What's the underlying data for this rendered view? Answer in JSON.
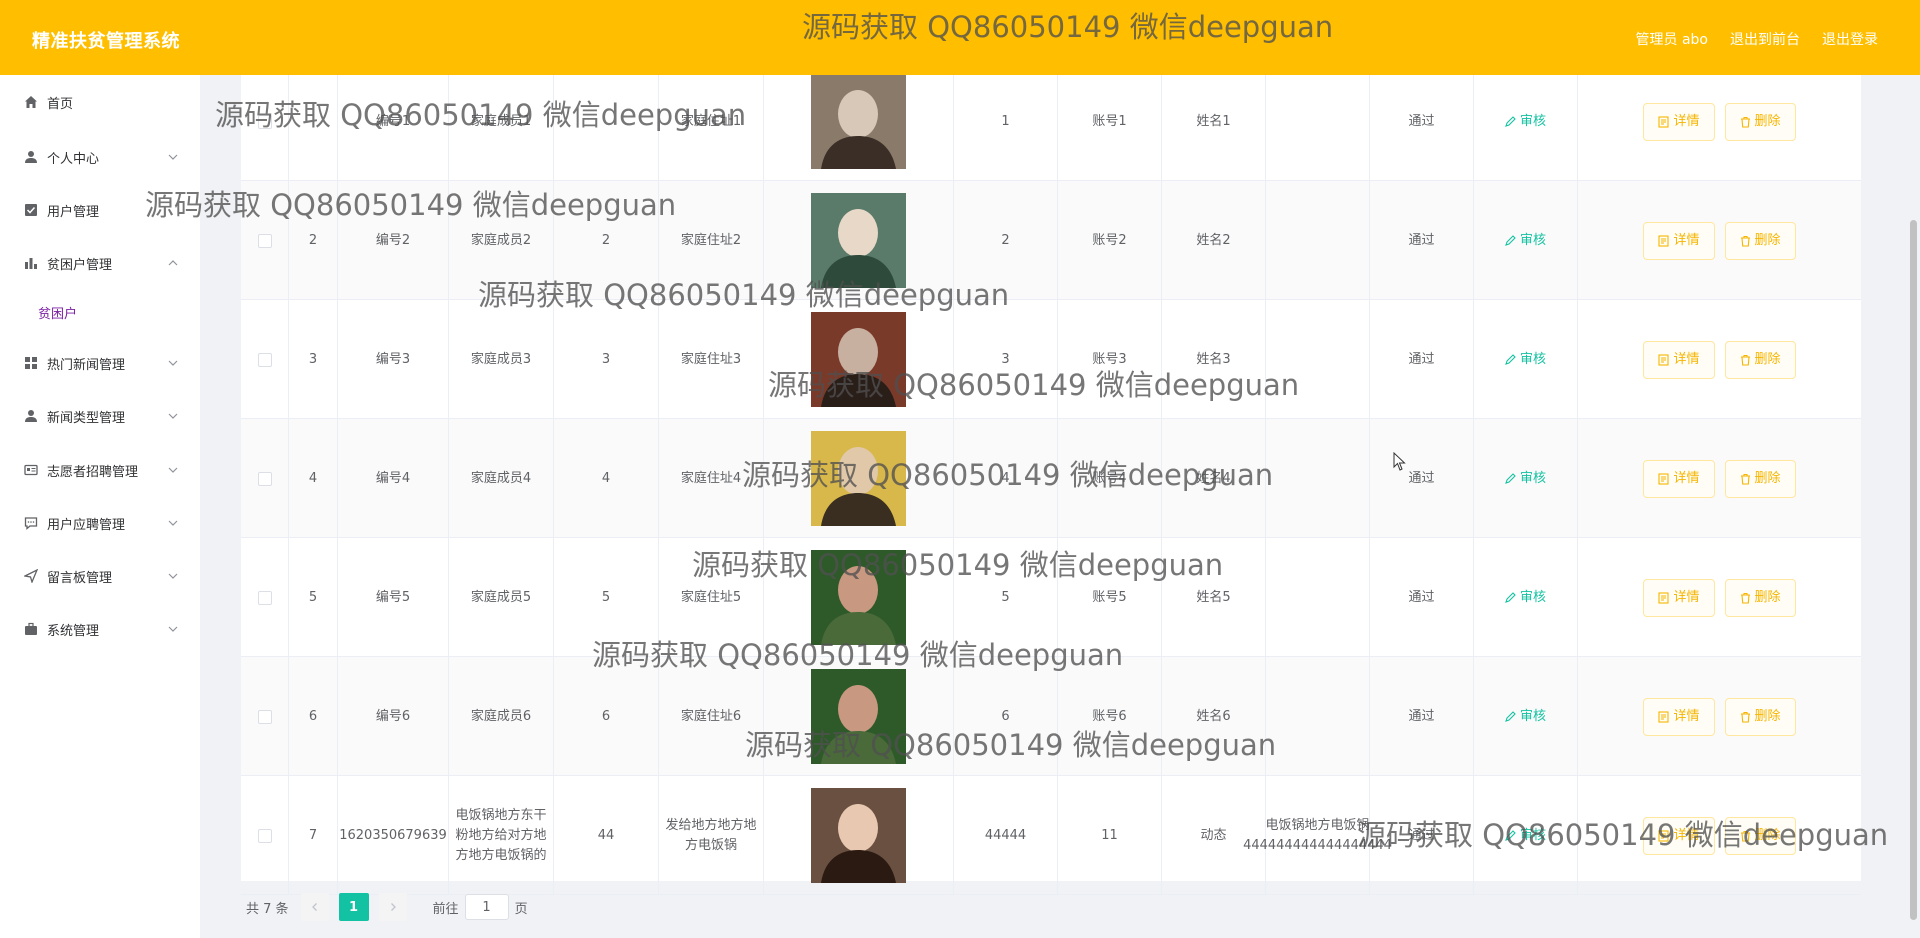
{
  "header": {
    "app_title": "精准扶贫管理系统",
    "admin_label": "管理员 abo",
    "to_front_label": "退出到前台",
    "logout_label": "退出登录"
  },
  "sidebar": {
    "items": [
      {
        "label": "首页",
        "icon": "home-icon"
      },
      {
        "label": "个人中心",
        "icon": "user-icon"
      },
      {
        "label": "用户管理",
        "icon": "check-square-icon"
      },
      {
        "label": "贫困户管理",
        "icon": "bar-chart-icon"
      },
      {
        "label": "热门新闻管理",
        "icon": "grid-icon"
      },
      {
        "label": "新闻类型管理",
        "icon": "user-icon"
      },
      {
        "label": "志愿者招聘管理",
        "icon": "id-card-icon"
      },
      {
        "label": "用户应聘管理",
        "icon": "chat-icon"
      },
      {
        "label": "留言板管理",
        "icon": "send-icon"
      },
      {
        "label": "系统管理",
        "icon": "briefcase-icon"
      }
    ],
    "submenu": {
      "label": "贫困户"
    }
  },
  "table": {
    "rows": [
      {
        "index": "",
        "code": "编号1",
        "family": "家庭成员1",
        "count": "",
        "address": "家庭住址1",
        "num": "1",
        "account": "账号1",
        "name": "姓名1",
        "extra": "",
        "status": "通过"
      },
      {
        "index": "2",
        "code": "编号2",
        "family": "家庭成员2",
        "count": "2",
        "address": "家庭住址2",
        "num": "2",
        "account": "账号2",
        "name": "姓名2",
        "extra": "",
        "status": "通过"
      },
      {
        "index": "3",
        "code": "编号3",
        "family": "家庭成员3",
        "count": "3",
        "address": "家庭住址3",
        "num": "3",
        "account": "账号3",
        "name": "姓名3",
        "extra": "",
        "status": "通过"
      },
      {
        "index": "4",
        "code": "编号4",
        "family": "家庭成员4",
        "count": "4",
        "address": "家庭住址4",
        "num": "4",
        "account": "账号4",
        "name": "姓名4",
        "extra": "",
        "status": "通过"
      },
      {
        "index": "5",
        "code": "编号5",
        "family": "家庭成员5",
        "count": "5",
        "address": "家庭住址5",
        "num": "5",
        "account": "账号5",
        "name": "姓名5",
        "extra": "",
        "status": "通过"
      },
      {
        "index": "6",
        "code": "编号6",
        "family": "家庭成员6",
        "count": "6",
        "address": "家庭住址6",
        "num": "6",
        "account": "账号6",
        "name": "姓名6",
        "extra": "",
        "status": "通过"
      },
      {
        "index": "7",
        "code": "1620350679639",
        "family": "电饭锅地方东干粉地方给对方地方地方电饭锅的",
        "count": "44",
        "address": "发给地方地方地方电饭锅",
        "num": "44444",
        "account": "11",
        "name": "动态",
        "extra": "电饭锅地方电饭锅444444444444444444",
        "status": "通过"
      }
    ],
    "review_label": "审核",
    "detail_label": "详情",
    "delete_label": "删除"
  },
  "pagination": {
    "total": "共 7 条",
    "current_page": "1",
    "goto_prefix": "前往",
    "goto_value": "1",
    "goto_suffix": "页"
  },
  "watermark": "源码获取 QQ86050149 微信deepguan",
  "colors": {
    "header": "#ffbf00",
    "accent_green": "#13c2a2",
    "button_text": "#f6b500",
    "submenu_active": "#7b1fa2"
  }
}
